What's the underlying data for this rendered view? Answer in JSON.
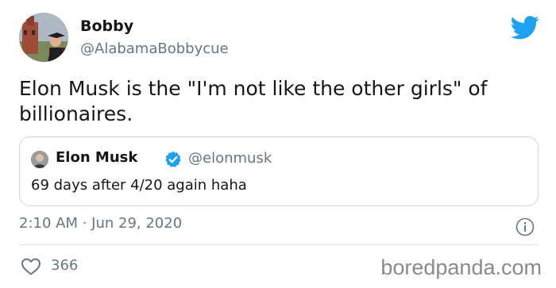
{
  "tweet": {
    "author_name": "Bobby",
    "author_handle": "@AlabamaBobbycue",
    "text": "Elon Musk is the \"I'm not like the other girls\" of billionaires.",
    "timestamp": "2:10 AM · Jun 29, 2020",
    "like_count": "366"
  },
  "quoted_tweet": {
    "author_name": "Elon Musk",
    "author_handle": "@elonmusk",
    "text": "69 days after 4/20 again haha",
    "verified": true
  },
  "watermark": "boredpanda.com",
  "icons": {
    "platform": "twitter-bird-icon",
    "verified": "verified-badge-icon",
    "info": "info-icon",
    "like": "heart-icon"
  },
  "colors": {
    "brand_blue": "#1da1f2",
    "secondary_text": "#657786",
    "primary_text": "#14171a",
    "border": "#ccd6dd"
  }
}
